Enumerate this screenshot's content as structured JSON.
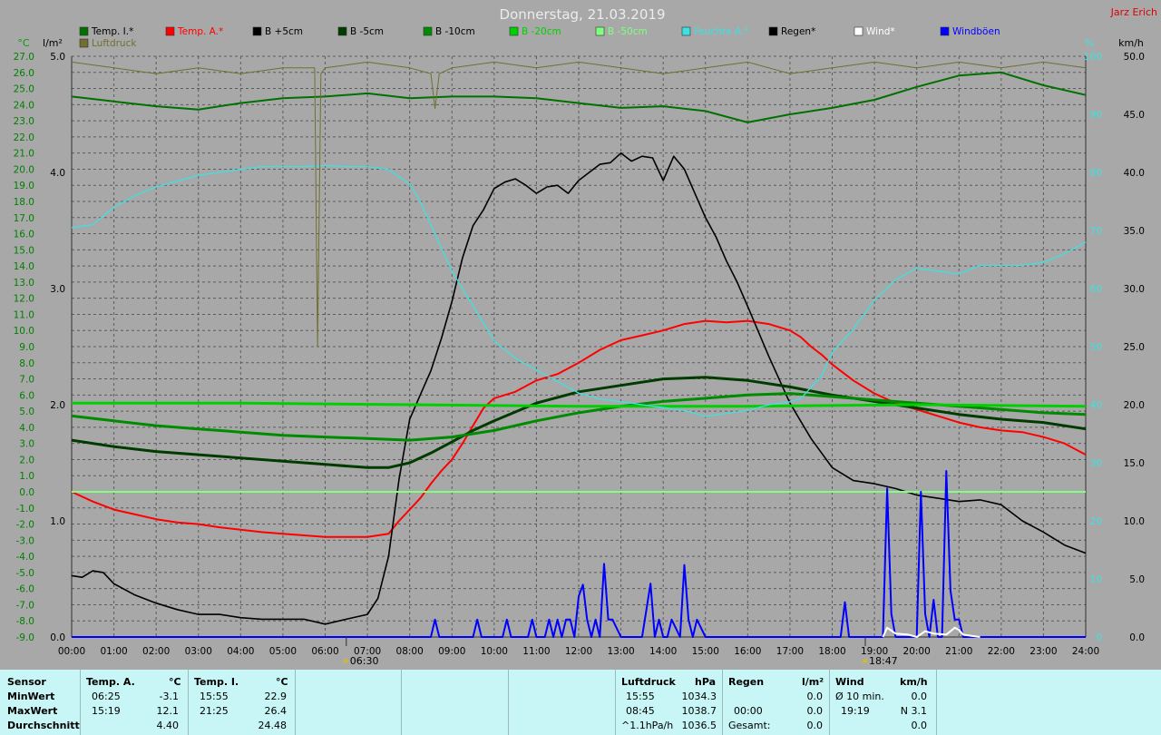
{
  "page": {
    "title": "Donnerstag, 21.03.2019",
    "author": "Jarz Erich"
  },
  "legend": [
    {
      "label": "Temp. I.*",
      "color": "#007000"
    },
    {
      "label": "Temp. A.*",
      "color": "#ff0000"
    },
    {
      "label": "B +5cm",
      "color": "#000000"
    },
    {
      "label": "B -5cm",
      "color": "#003c00"
    },
    {
      "label": "B -10cm",
      "color": "#008c00"
    },
    {
      "label": "B -20cm",
      "color": "#00d000"
    },
    {
      "label": "B -50cm",
      "color": "#80ff80"
    },
    {
      "label": "Feuchte A.*",
      "color": "#40e0e0"
    },
    {
      "label": "Regen*",
      "color": "#000000"
    },
    {
      "label": "Wind*",
      "color": "#ffffff"
    },
    {
      "label": "Windböen",
      "color": "#0000ff"
    },
    {
      "label": "Luftdruck",
      "color": "#707030"
    }
  ],
  "axis_units": {
    "temp": "°C",
    "rain": "l/m²",
    "humidity": "%",
    "wind": "km/h"
  },
  "sun": {
    "rise": "06:30",
    "set": "18:47"
  },
  "chart_data": {
    "type": "line",
    "title": "Donnerstag, 21.03.2019",
    "x_ticks": [
      "00:00",
      "01:00",
      "02:00",
      "03:00",
      "04:00",
      "05:00",
      "06:00",
      "07:00",
      "08:00",
      "09:00",
      "10:00",
      "11:00",
      "12:00",
      "13:00",
      "14:00",
      "15:00",
      "16:00",
      "17:00",
      "18:00",
      "19:00",
      "20:00",
      "21:00",
      "22:00",
      "23:00",
      "24:00"
    ],
    "xlim_hours": [
      0,
      24
    ],
    "y_left_temp": {
      "label": "°C",
      "lim": [
        -9,
        27
      ],
      "ticks": [
        "-9.0",
        "-8.0",
        "-7.0",
        "-6.0",
        "-5.0",
        "-4.0",
        "-3.0",
        "-2.0",
        "-1.0",
        "0.0",
        "1.0",
        "2.0",
        "3.0",
        "4.0",
        "5.0",
        "6.0",
        "7.0",
        "8.0",
        "9.0",
        "10.0",
        "11.0",
        "12.0",
        "13.0",
        "14.0",
        "15.0",
        "16.0",
        "17.0",
        "18.0",
        "19.0",
        "20.0",
        "21.0",
        "22.0",
        "23.0",
        "24.0",
        "25.0",
        "26.0",
        "27.0"
      ]
    },
    "y_left_rain": {
      "label": "l/m²",
      "lim": [
        0,
        5
      ],
      "ticks": [
        "0.0",
        "1.0",
        "2.0",
        "3.0",
        "4.0",
        "5.0"
      ]
    },
    "y_right_humidity": {
      "label": "%",
      "lim": [
        0,
        100
      ],
      "ticks": [
        "0",
        "10",
        "20",
        "30",
        "40",
        "50",
        "60",
        "70",
        "80",
        "90",
        "100"
      ]
    },
    "y_right_wind": {
      "label": "km/h",
      "lim": [
        0,
        50
      ],
      "ticks": [
        "0.0",
        "5.0",
        "10.0",
        "15.0",
        "20.0",
        "25.0",
        "30.0",
        "35.0",
        "40.0",
        "45.0",
        "50.0"
      ]
    },
    "series": [
      {
        "name": "Temp. I.*",
        "axis": "temp",
        "color": "#007000",
        "x": [
          0,
          1,
          2,
          3,
          4,
          5,
          6,
          7,
          8,
          9,
          10,
          11,
          12,
          13,
          14,
          15,
          16,
          17,
          18,
          19,
          20,
          21,
          22,
          23,
          24
        ],
        "y": [
          24.5,
          24.2,
          23.9,
          23.7,
          24.1,
          24.4,
          24.5,
          24.7,
          24.4,
          24.5,
          24.5,
          24.4,
          24.1,
          23.8,
          23.9,
          23.6,
          22.9,
          23.4,
          23.8,
          24.3,
          25.1,
          25.8,
          26.0,
          25.2,
          24.6
        ]
      },
      {
        "name": "Temp. A.*",
        "axis": "temp",
        "color": "#ff0000",
        "x": [
          0,
          0.5,
          1,
          1.5,
          2,
          2.5,
          3,
          3.5,
          4,
          4.5,
          5,
          5.5,
          6,
          6.5,
          7,
          7.25,
          7.5,
          7.75,
          8,
          8.25,
          8.5,
          8.75,
          9,
          9.25,
          9.5,
          9.75,
          10,
          10.5,
          11,
          11.5,
          12,
          12.5,
          13,
          13.5,
          14,
          14.5,
          15,
          15.5,
          16,
          16.5,
          17,
          17.25,
          17.5,
          17.75,
          18,
          18.5,
          19,
          19.5,
          20,
          20.5,
          21,
          21.5,
          22,
          22.5,
          23,
          23.5,
          24
        ],
        "y": [
          0,
          -0.6,
          -1.1,
          -1.4,
          -1.7,
          -1.9,
          -2.0,
          -2.2,
          -2.35,
          -2.5,
          -2.6,
          -2.7,
          -2.8,
          -2.8,
          -2.8,
          -2.7,
          -2.6,
          -1.8,
          -1.1,
          -0.4,
          0.5,
          1.3,
          2.0,
          3.0,
          4.1,
          5.2,
          5.8,
          6.2,
          6.9,
          7.3,
          8.0,
          8.8,
          9.4,
          9.7,
          10.0,
          10.4,
          10.6,
          10.5,
          10.6,
          10.4,
          10.0,
          9.6,
          9.0,
          8.5,
          7.9,
          6.9,
          6.1,
          5.5,
          5.1,
          4.7,
          4.3,
          4.0,
          3.8,
          3.7,
          3.4,
          3.0,
          2.3
        ]
      },
      {
        "name": "B +5cm",
        "axis": "temp",
        "color": "#000000",
        "x": [
          0,
          0.25,
          0.5,
          0.75,
          1,
          1.5,
          2,
          2.5,
          3,
          3.5,
          4,
          4.5,
          5,
          5.5,
          6,
          6.5,
          7,
          7.25,
          7.5,
          7.75,
          8,
          8.25,
          8.5,
          8.75,
          9,
          9.25,
          9.5,
          9.75,
          10,
          10.25,
          10.5,
          10.75,
          11,
          11.25,
          11.5,
          11.75,
          12,
          12.25,
          12.5,
          12.75,
          13,
          13.25,
          13.5,
          13.75,
          14,
          14.25,
          14.5,
          14.75,
          15,
          15.25,
          15.5,
          15.75,
          16,
          16.5,
          17,
          17.5,
          18,
          18.5,
          19,
          19.5,
          20,
          20.5,
          21,
          21.5,
          22,
          22.5,
          23,
          23.5,
          24
        ],
        "y": [
          -5.2,
          -5.3,
          -4.9,
          -5.0,
          -5.7,
          -6.4,
          -6.9,
          -7.3,
          -7.6,
          -7.6,
          -7.8,
          -7.9,
          -7.9,
          -7.9,
          -8.2,
          -7.9,
          -7.6,
          -6.6,
          -4.0,
          0.8,
          4.5,
          6.0,
          7.5,
          9.5,
          11.8,
          14.5,
          16.5,
          17.5,
          18.8,
          19.2,
          19.4,
          19.0,
          18.5,
          18.9,
          19.0,
          18.5,
          19.3,
          19.8,
          20.3,
          20.4,
          21.0,
          20.5,
          20.8,
          20.7,
          19.3,
          20.8,
          20.0,
          18.5,
          17.0,
          15.8,
          14.3,
          13.0,
          11.5,
          8.4,
          5.5,
          3.3,
          1.5,
          0.7,
          0.5,
          0.2,
          -0.2,
          -0.4,
          -0.6,
          -0.5,
          -0.8,
          -1.8,
          -2.5,
          -3.3,
          -3.8
        ]
      },
      {
        "name": "B -5cm",
        "axis": "temp",
        "color": "#003c00",
        "x": [
          0,
          1,
          2,
          3,
          4,
          5,
          6,
          7,
          7.5,
          8,
          8.5,
          9,
          9.5,
          10,
          11,
          12,
          13,
          14,
          15,
          16,
          17,
          18,
          19,
          20,
          21,
          22,
          23,
          24
        ],
        "y": [
          3.2,
          2.8,
          2.5,
          2.3,
          2.1,
          1.9,
          1.7,
          1.5,
          1.5,
          1.8,
          2.4,
          3.1,
          3.8,
          4.4,
          5.5,
          6.2,
          6.6,
          7.0,
          7.1,
          6.9,
          6.5,
          6.0,
          5.6,
          5.2,
          4.8,
          4.5,
          4.3,
          3.9
        ]
      },
      {
        "name": "B -10cm",
        "axis": "temp",
        "color": "#008c00",
        "x": [
          0,
          1,
          2,
          3,
          4,
          5,
          6,
          7,
          8,
          9,
          10,
          11,
          12,
          13,
          14,
          15,
          16,
          17,
          18,
          19,
          20,
          21,
          22,
          23,
          24
        ],
        "y": [
          4.7,
          4.4,
          4.1,
          3.9,
          3.7,
          3.5,
          3.4,
          3.3,
          3.2,
          3.4,
          3.8,
          4.4,
          4.9,
          5.3,
          5.6,
          5.8,
          6.0,
          6.1,
          5.9,
          5.7,
          5.5,
          5.3,
          5.1,
          4.9,
          4.8
        ]
      },
      {
        "name": "B -20cm",
        "axis": "temp",
        "color": "#00d000",
        "x": [
          0,
          4,
          8,
          12,
          16,
          20,
          24
        ],
        "y": [
          5.5,
          5.5,
          5.4,
          5.3,
          5.3,
          5.4,
          5.3
        ]
      },
      {
        "name": "B -50cm",
        "axis": "temp",
        "color": "#80ff80",
        "x": [
          0,
          24
        ],
        "y": [
          0.0,
          0.0
        ]
      },
      {
        "name": "Feuchte A.*",
        "axis": "humidity",
        "color": "#40e0e0",
        "x": [
          0,
          0.5,
          1,
          1.5,
          2,
          2.5,
          3,
          3.5,
          4,
          4.5,
          5,
          5.5,
          6,
          6.5,
          7,
          7.5,
          8,
          8.25,
          8.5,
          8.75,
          9,
          9.25,
          9.5,
          9.75,
          10,
          10.5,
          11,
          11.5,
          12,
          12.5,
          13,
          13.5,
          14,
          14.5,
          15,
          15.5,
          16,
          16.5,
          17,
          17.25,
          17.5,
          17.75,
          18,
          18.5,
          19,
          19.5,
          20,
          20.5,
          21,
          21.5,
          22,
          22.5,
          23,
          23.5,
          24
        ],
        "y": [
          70.5,
          71,
          74,
          76,
          77.5,
          78.5,
          79.5,
          80,
          80.5,
          81,
          81,
          81,
          81.2,
          81,
          81,
          80.5,
          78,
          75,
          71,
          67,
          63,
          60,
          57,
          54,
          51,
          48,
          46,
          44,
          42,
          41,
          40.5,
          40,
          39.5,
          39,
          38,
          38.5,
          39,
          40,
          40.5,
          41,
          43,
          45,
          49,
          53,
          58,
          61.5,
          63.5,
          63,
          62.5,
          64,
          64,
          64,
          64.5,
          66,
          68
        ]
      },
      {
        "name": "Luftdruck",
        "axis": "humidity",
        "color": "#707030",
        "x": [
          0,
          1,
          2,
          3,
          4,
          5,
          5.75,
          5.82,
          5.9,
          6,
          7,
          8,
          8.5,
          8.6,
          8.7,
          9,
          10,
          11,
          12,
          13,
          14,
          15,
          16,
          17,
          18,
          19,
          20,
          21,
          22,
          23,
          24
        ],
        "y": [
          99,
          98,
          97,
          98,
          97,
          98,
          98,
          50,
          97,
          98,
          99,
          98,
          97,
          91,
          97,
          98,
          99,
          98,
          99,
          98,
          97,
          98,
          99,
          97,
          98,
          99,
          98,
          99,
          98,
          99,
          98
        ]
      },
      {
        "name": "Windböen",
        "axis": "wind",
        "color": "#0000ff",
        "x": [
          0,
          8.5,
          8.6,
          8.7,
          9.5,
          9.6,
          9.7,
          10.2,
          10.3,
          10.4,
          10.8,
          10.9,
          11.0,
          11.2,
          11.3,
          11.4,
          11.5,
          11.6,
          11.7,
          11.8,
          11.9,
          12.0,
          12.1,
          12.2,
          12.3,
          12.4,
          12.5,
          12.6,
          12.7,
          12.8,
          13.0,
          13.5,
          13.7,
          13.8,
          13.9,
          14.0,
          14.1,
          14.2,
          14.4,
          14.5,
          14.6,
          14.7,
          14.8,
          15.0,
          18.0,
          18.2,
          18.3,
          18.4,
          19.2,
          19.3,
          19.4,
          19.5,
          20.0,
          20.1,
          20.2,
          20.3,
          20.4,
          20.5,
          20.6,
          20.7,
          20.8,
          20.9,
          21.0,
          21.1,
          21.2,
          21.3,
          24
        ],
        "y": [
          0,
          0,
          1.5,
          0,
          0,
          1.5,
          0,
          0,
          1.5,
          0,
          0,
          1.5,
          0,
          0,
          1.5,
          0,
          1.5,
          0,
          1.5,
          1.5,
          0,
          3.5,
          4.5,
          1.5,
          0,
          1.5,
          0,
          6.3,
          1.5,
          1.5,
          0,
          0,
          4.6,
          0,
          1.5,
          0,
          0,
          1.5,
          0,
          6.2,
          1.5,
          0,
          1.5,
          0,
          0,
          0,
          3.0,
          0,
          0,
          12.8,
          2.0,
          0,
          0,
          12.5,
          2.0,
          0,
          3.2,
          0,
          0,
          14.3,
          4.0,
          1.5,
          1.5,
          0,
          0,
          0,
          0
        ]
      },
      {
        "name": "Wind*",
        "axis": "wind",
        "color": "#ffffff",
        "x": [
          19.2,
          19.3,
          19.5,
          19.8,
          20.0,
          20.2,
          20.4,
          20.7,
          20.9,
          21.0,
          21.1,
          21.3,
          21.5
        ],
        "y": [
          0,
          0.8,
          0.3,
          0.2,
          0,
          0.5,
          0.3,
          0.2,
          0.8,
          0.6,
          0.2,
          0.1,
          0
        ]
      }
    ]
  },
  "stats": {
    "sensor_label": "Sensor",
    "rows": [
      "MinWert",
      "MaxWert",
      "Durchschnitt"
    ],
    "temp_a": {
      "header": "Temp. A.",
      "unit": "°C",
      "min_time": "06:25",
      "min": "-3.1",
      "max_time": "15:19",
      "max": "12.1",
      "avg": "4.40"
    },
    "temp_i": {
      "header": "Temp. I.",
      "unit": "°C",
      "min_time": "15:55",
      "min": "22.9",
      "max_time": "21:25",
      "max": "26.4",
      "avg": "24.48"
    },
    "pressure": {
      "header": "Luftdruck",
      "unit": "hPa",
      "t1": "15:55",
      "v1": "1034.3",
      "t2": "08:45",
      "v2": "1038.7",
      "t3": "^1.1hPa/h",
      "v3": "1036.5"
    },
    "rain": {
      "header": "Regen",
      "unit": "l/m²",
      "v1": "0.0",
      "t2": "00:00",
      "v2": "0.0",
      "t3": "Gesamt:",
      "v3": "0.0"
    },
    "wind": {
      "header": "Wind",
      "unit": "km/h",
      "t1": "Ø 10 min.",
      "v1": "0.0",
      "t2": "19:19",
      "v2": "N 3.1",
      "v3": "0.0"
    }
  }
}
